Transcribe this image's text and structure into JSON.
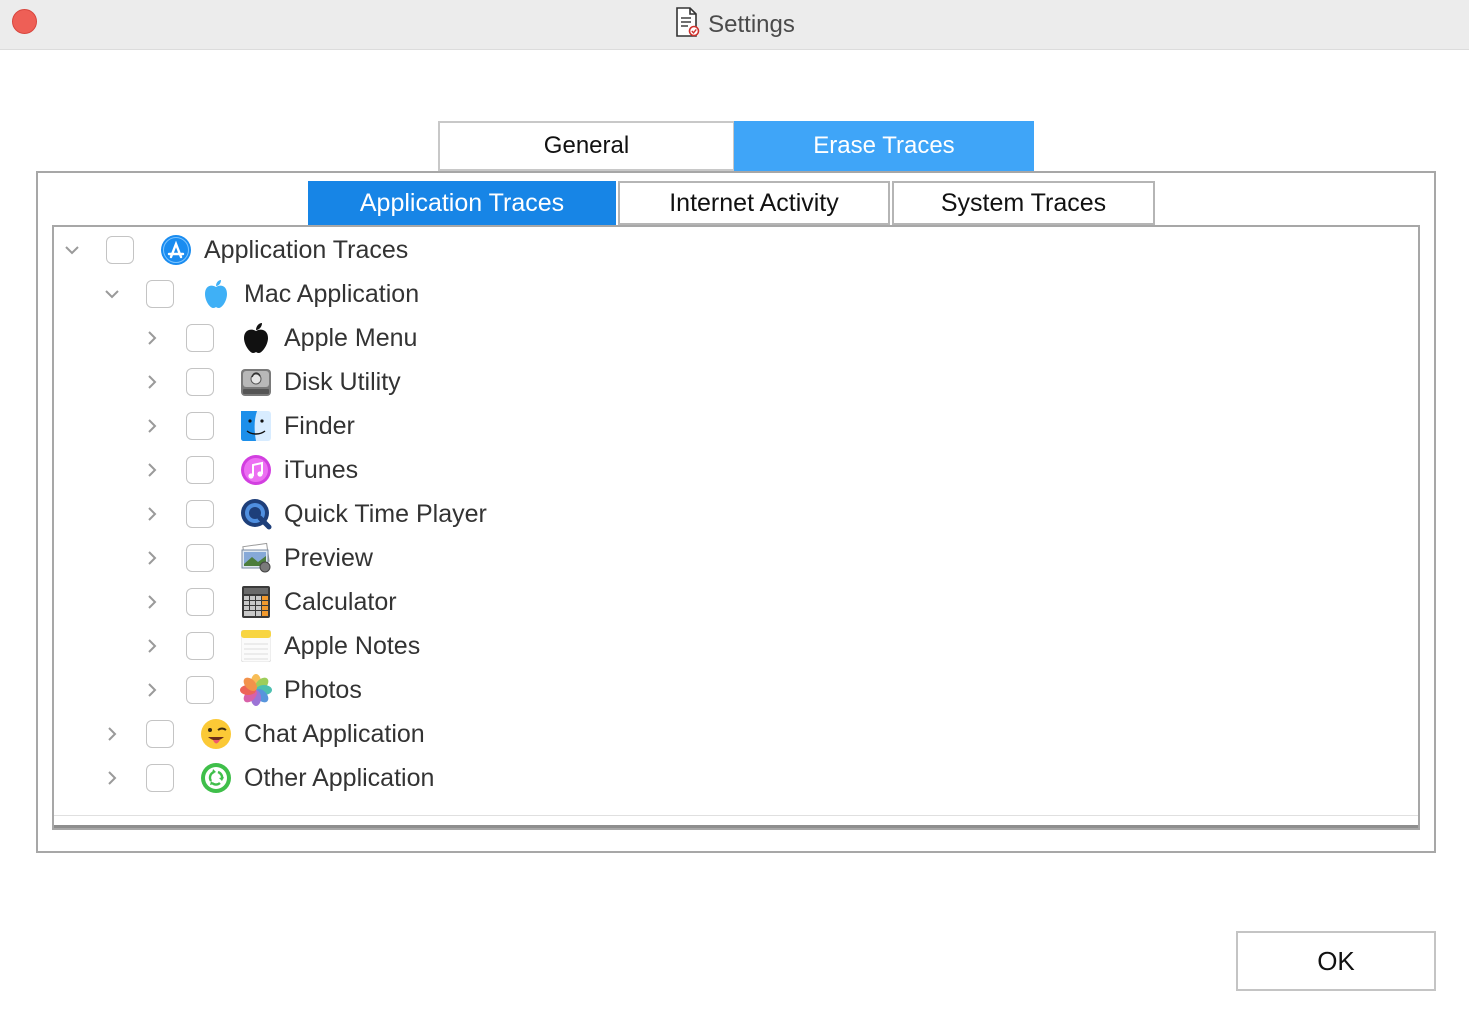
{
  "window": {
    "title": "Settings",
    "title_icon": "settings-document-icon"
  },
  "main_tabs": [
    {
      "label": "General",
      "selected": false
    },
    {
      "label": "Erase Traces",
      "selected": true
    }
  ],
  "sub_tabs": [
    {
      "label": "Application Traces",
      "selected": true
    },
    {
      "label": "Internet Activity",
      "selected": false
    },
    {
      "label": "System Traces",
      "selected": false
    }
  ],
  "tree": [
    {
      "label": "Application Traces",
      "level": 0,
      "expanded": true,
      "checked": false,
      "icon": "app-store-icon"
    },
    {
      "label": "Mac Application",
      "level": 1,
      "expanded": true,
      "checked": false,
      "icon": "mac-apple-blue-icon"
    },
    {
      "label": "Apple Menu",
      "level": 2,
      "expanded": false,
      "checked": false,
      "icon": "apple-logo-icon"
    },
    {
      "label": "Disk Utility",
      "level": 2,
      "expanded": false,
      "checked": false,
      "icon": "disk-utility-icon"
    },
    {
      "label": "Finder",
      "level": 2,
      "expanded": false,
      "checked": false,
      "icon": "finder-icon"
    },
    {
      "label": "iTunes",
      "level": 2,
      "expanded": false,
      "checked": false,
      "icon": "itunes-icon"
    },
    {
      "label": "Quick Time Player",
      "level": 2,
      "expanded": false,
      "checked": false,
      "icon": "quicktime-icon"
    },
    {
      "label": "Preview",
      "level": 2,
      "expanded": false,
      "checked": false,
      "icon": "preview-icon"
    },
    {
      "label": "Calculator",
      "level": 2,
      "expanded": false,
      "checked": false,
      "icon": "calculator-icon"
    },
    {
      "label": "Apple Notes",
      "level": 2,
      "expanded": false,
      "checked": false,
      "icon": "notes-icon"
    },
    {
      "label": "Photos",
      "level": 2,
      "expanded": false,
      "checked": false,
      "icon": "photos-icon"
    },
    {
      "label": "Chat Application",
      "level": 1,
      "expanded": false,
      "checked": false,
      "icon": "chat-emoji-icon"
    },
    {
      "label": "Other Application",
      "level": 1,
      "expanded": false,
      "checked": false,
      "icon": "other-app-recycle-icon"
    }
  ],
  "footer": {
    "ok_label": "OK"
  },
  "colors": {
    "main_tab_selected": "#3fa5f8",
    "sub_tab_selected": "#1785e6",
    "close_button": "#ee5f56"
  }
}
